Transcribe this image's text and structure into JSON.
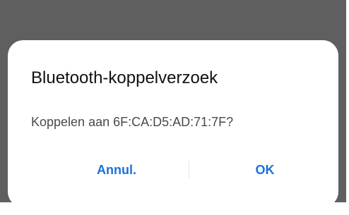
{
  "dialog": {
    "title": "Bluetooth-koppelverzoek",
    "message": "Koppelen aan 6F:CA:D5:AD:71:7F?",
    "cancel_label": "Annul.",
    "ok_label": "OK"
  },
  "colors": {
    "overlay": "#5f5f5f",
    "dialog_background": "#ffffff",
    "accent": "#1a73d9"
  }
}
